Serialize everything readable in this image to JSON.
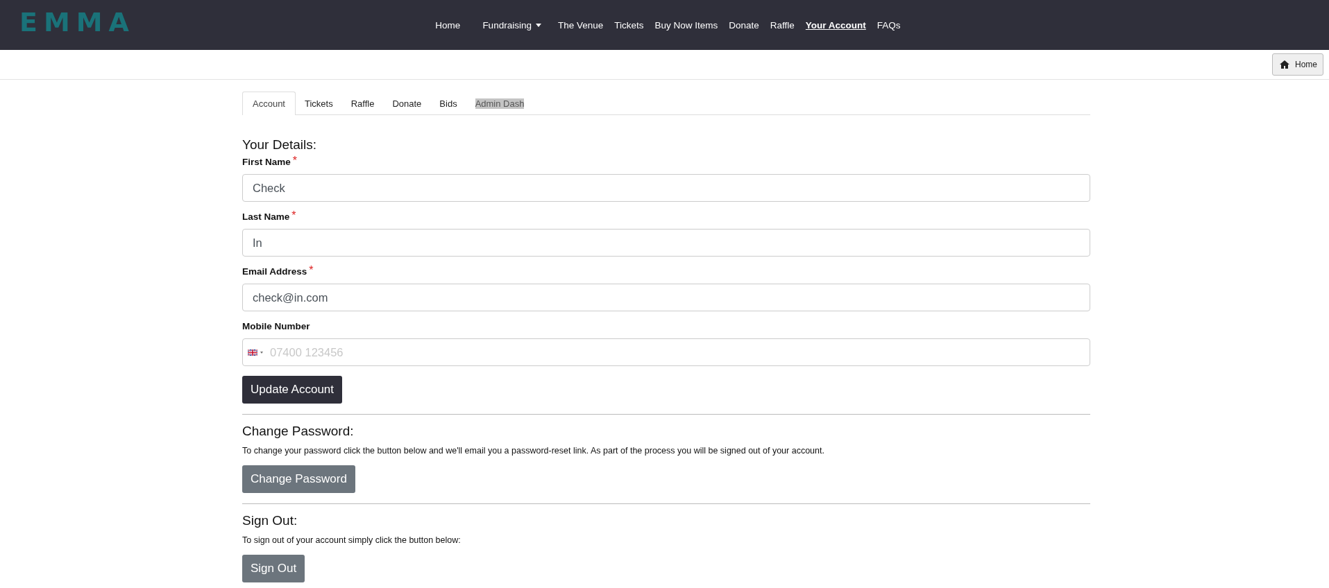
{
  "header": {
    "logo": "EMMA",
    "nav": [
      {
        "label": "Home",
        "selected": false,
        "kind": "link"
      },
      {
        "label": "Fundraising",
        "selected": false,
        "kind": "dropdown"
      },
      {
        "label": "The Venue",
        "selected": false,
        "kind": "link"
      },
      {
        "label": "Tickets",
        "selected": false,
        "kind": "link"
      },
      {
        "label": "Buy Now Items",
        "selected": false,
        "kind": "link"
      },
      {
        "label": "Donate",
        "selected": false,
        "kind": "link"
      },
      {
        "label": "Raffle",
        "selected": false,
        "kind": "link"
      },
      {
        "label": "Your Account",
        "selected": true,
        "kind": "link"
      },
      {
        "label": "FAQs",
        "selected": false,
        "kind": "link"
      }
    ]
  },
  "toolbar": {
    "home_button": "Home"
  },
  "tabs": [
    {
      "label": "Account",
      "selected": true,
      "highlighted": false
    },
    {
      "label": "Tickets",
      "selected": false,
      "highlighted": false
    },
    {
      "label": "Raffle",
      "selected": false,
      "highlighted": false
    },
    {
      "label": "Donate",
      "selected": false,
      "highlighted": false
    },
    {
      "label": "Bids",
      "selected": false,
      "highlighted": false
    },
    {
      "label": "Admin Dash",
      "selected": false,
      "highlighted": true
    }
  ],
  "details": {
    "heading": "Your Details:",
    "fields": [
      {
        "label": "First Name",
        "required_mark": "*",
        "kind": "text",
        "value": "Check"
      },
      {
        "label": "Last Name",
        "required_mark": "*",
        "kind": "text",
        "value": "In"
      },
      {
        "label": "Email Address",
        "required_mark": "*",
        "kind": "text",
        "value": "check@in.com"
      },
      {
        "label": "Mobile Number",
        "kind": "phone",
        "placeholder": "07400 123456"
      }
    ],
    "button": "Update Account"
  },
  "sections": [
    {
      "heading": "Change Password:",
      "text": "To change your password click the button below and we'll email you a password-reset link. As part of the process you will be signed out of your account.",
      "button": "Change Password"
    },
    {
      "heading": "Sign Out:",
      "text": "To sign out of your account simply click the button below:",
      "button": "Sign Out"
    }
  ]
}
